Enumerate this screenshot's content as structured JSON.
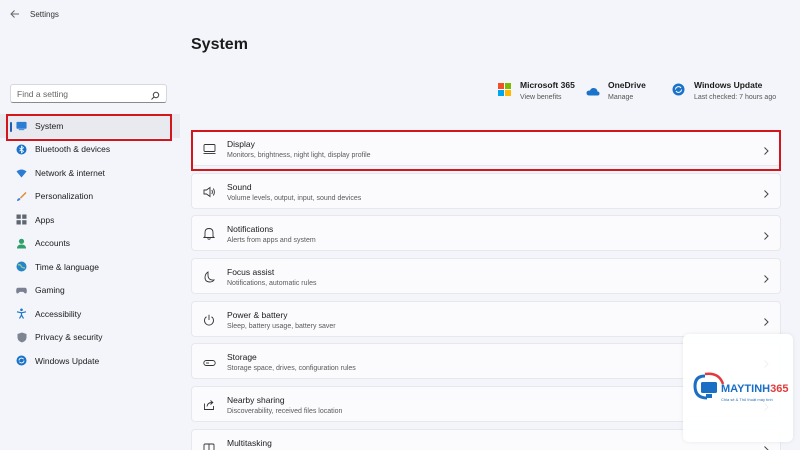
{
  "window": {
    "title": "Settings"
  },
  "search": {
    "placeholder": "Find a setting"
  },
  "sidebar": {
    "items": [
      {
        "label": "System",
        "icon": "monitor-icon",
        "active": true
      },
      {
        "label": "Bluetooth & devices",
        "icon": "bluetooth-icon"
      },
      {
        "label": "Network & internet",
        "icon": "wifi-icon"
      },
      {
        "label": "Personalization",
        "icon": "brush-icon"
      },
      {
        "label": "Apps",
        "icon": "apps-icon"
      },
      {
        "label": "Accounts",
        "icon": "person-icon"
      },
      {
        "label": "Time & language",
        "icon": "globe-icon"
      },
      {
        "label": "Gaming",
        "icon": "gamepad-icon"
      },
      {
        "label": "Accessibility",
        "icon": "accessibility-icon"
      },
      {
        "label": "Privacy & security",
        "icon": "shield-icon"
      },
      {
        "label": "Windows Update",
        "icon": "update-icon"
      }
    ]
  },
  "main": {
    "title": "System",
    "quick_links": [
      {
        "title": "Microsoft 365",
        "sub": "View benefits",
        "icon": "microsoft-logo-icon"
      },
      {
        "title": "OneDrive",
        "sub": "Manage",
        "icon": "cloud-icon"
      },
      {
        "title": "Windows Update",
        "sub": "Last checked: 7 hours ago",
        "icon": "update-icon"
      }
    ],
    "cards": [
      {
        "title": "Display",
        "sub": "Monitors, brightness, night light, display profile",
        "icon": "display-icon"
      },
      {
        "title": "Sound",
        "sub": "Volume levels, output, input, sound devices",
        "icon": "speaker-icon"
      },
      {
        "title": "Notifications",
        "sub": "Alerts from apps and system",
        "icon": "bell-icon"
      },
      {
        "title": "Focus assist",
        "sub": "Notifications, automatic rules",
        "icon": "moon-icon"
      },
      {
        "title": "Power & battery",
        "sub": "Sleep, battery usage, battery saver",
        "icon": "power-icon"
      },
      {
        "title": "Storage",
        "sub": "Storage space, drives, configuration rules",
        "icon": "storage-icon"
      },
      {
        "title": "Nearby sharing",
        "sub": "Discoverability, received files location",
        "icon": "share-icon"
      },
      {
        "title": "Multitasking",
        "sub": "",
        "icon": "multitask-icon"
      }
    ]
  },
  "watermark": {
    "brand": "MAYTINH365",
    "tagline": "Chia sẻ & Thủ thuật máy tính"
  },
  "colors": {
    "accent": "#1a5fb4",
    "highlight": "#d3151c",
    "background": "#f3f5fa"
  }
}
